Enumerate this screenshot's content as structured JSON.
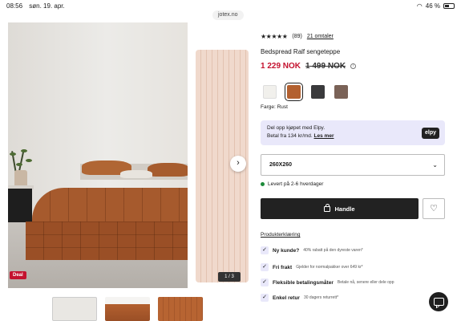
{
  "status_bar": {
    "time": "08:56",
    "date": "søn. 19. apr.",
    "battery": "46 %"
  },
  "browser": {
    "url": "jotex.no"
  },
  "gallery": {
    "deal_badge": "Deal",
    "counter": "1 / 3"
  },
  "product": {
    "rating_stars": "★★★★★",
    "rating_value": 4.5,
    "rating_count": "(89)",
    "reviews_link": "21 omtaler",
    "title": "Bedspread Ralf sengeteppe",
    "price_now": "1 229 NOK",
    "price_old": "1 499 NOK",
    "color_label": "Farge: Rust",
    "swatches": [
      {
        "name": "white",
        "color": "#f1f0ec"
      },
      {
        "name": "rust",
        "color": "#b3602f"
      },
      {
        "name": "charcoal",
        "color": "#3a3a3c"
      },
      {
        "name": "brown",
        "color": "#7a6257"
      }
    ]
  },
  "elpy": {
    "line1": "Del opp kjøpet med Elpy.",
    "line2": "Betal fra 134 kr/md.",
    "link": "Les mer",
    "logo": "elpy"
  },
  "size_select": {
    "value": "260X260"
  },
  "stock": {
    "text": "Levert på 2-6 hverdager"
  },
  "buy_button": {
    "label": "Handle"
  },
  "benefits": {
    "link": "Produkterklæring",
    "items": [
      {
        "title": "Ny kunde?",
        "sub": "40% rabatt på den dyreste varen*"
      },
      {
        "title": "Fri frakt",
        "sub": "Gjelder for normalpakker over 649 kr*"
      },
      {
        "title": "Fleksible betalingsmåter",
        "sub": "Betale nå, senere eller dele opp"
      },
      {
        "title": "Enkel retur",
        "sub": "30 dagers returrett*"
      }
    ]
  }
}
